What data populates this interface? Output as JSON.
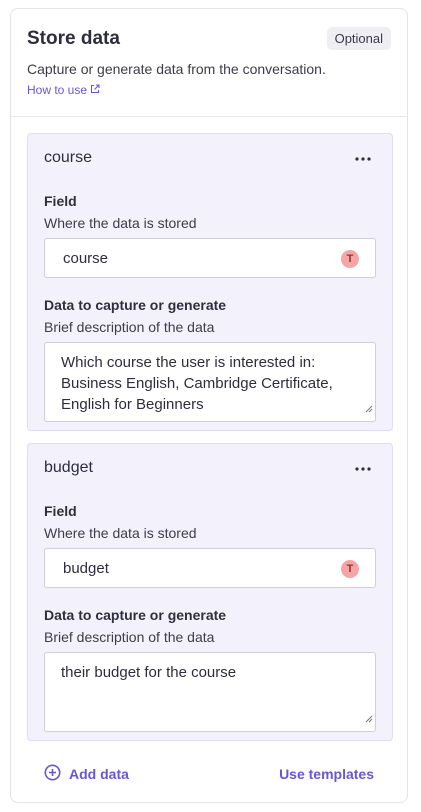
{
  "header": {
    "title": "Store data",
    "badge": "Optional",
    "subtitle": "Capture or generate data from the conversation.",
    "how_to_link": "How to use"
  },
  "cards": [
    {
      "name": "course",
      "field_label": "Field",
      "field_hint": "Where the data is stored",
      "field_value": "course",
      "field_badge": "T",
      "desc_label": "Data to capture or generate",
      "desc_hint": "Brief description of the data",
      "desc_value": "Which course the user is interested in: Business English, Cambridge Certificate, English for Beginners"
    },
    {
      "name": "budget",
      "field_label": "Field",
      "field_hint": "Where the data is stored",
      "field_value": "budget",
      "field_badge": "T",
      "desc_label": "Data to capture or generate",
      "desc_hint": "Brief description of the data",
      "desc_value": "their budget for the course"
    }
  ],
  "footer": {
    "add_label": "Add data",
    "templates_label": "Use templates"
  },
  "colors": {
    "accent": "#6b55d6",
    "card_bg": "#f2f1fc",
    "type_badge": "#f4a6a6"
  },
  "icons": {
    "external": "external-link-icon",
    "menu": "more-horizontal-icon",
    "add": "plus-circle-icon",
    "resize": "resize-handle-icon"
  }
}
